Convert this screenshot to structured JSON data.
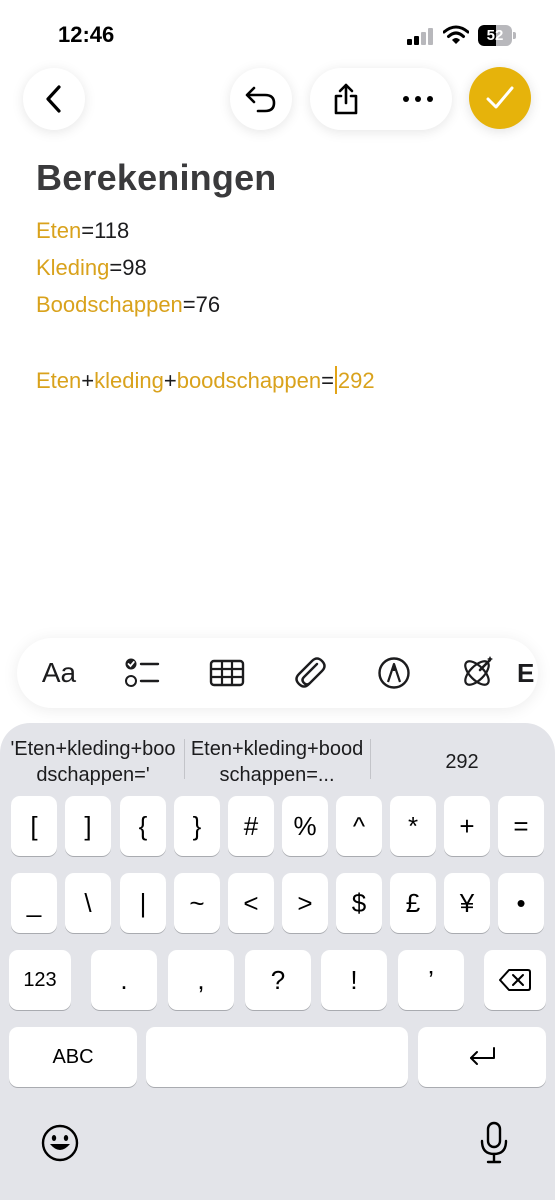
{
  "status_bar": {
    "time": "12:46",
    "battery": "52",
    "battery_level": 0.52
  },
  "toolbar": {
    "back_icon": "chevron-left-icon",
    "undo_icon": "undo-icon",
    "share_icon": "share-icon",
    "more_icon": "ellipsis-icon",
    "done_icon": "checkmark-icon",
    "accent_color": "#e6b30b"
  },
  "note": {
    "title": "Berekeningen",
    "lines": [
      {
        "var": "Eten",
        "rest": "=118"
      },
      {
        "var": "Kleding",
        "rest": "=98"
      },
      {
        "var": "Boodschappen",
        "rest": "=76"
      }
    ],
    "formula": {
      "a": "Eten",
      "op1": "+",
      "b": "kleding",
      "op2": "+",
      "c": "boodschappen",
      "eq": "=",
      "result": "292"
    },
    "variable_color": "#d9a21c"
  },
  "format_bar": {
    "text_style": "Aa",
    "icons": [
      "checklist-icon",
      "table-icon",
      "attachment-icon",
      "markup-icon",
      "writing-tools-icon"
    ]
  },
  "keyboard": {
    "suggestions": [
      "'Eten+kleding+boodschappen='",
      "Eten+kleding+boodschappen=...",
      "292"
    ],
    "row1": [
      "[",
      "]",
      "{",
      "}",
      "#",
      "%",
      "^",
      "*",
      "+",
      "="
    ],
    "row2": [
      "_",
      "\\",
      "|",
      "~",
      "<",
      ">",
      "$",
      "£",
      "¥",
      "•"
    ],
    "row3_mode": "123",
    "row3": [
      ".",
      ",",
      "?",
      "!",
      "’"
    ],
    "abc_label": "ABC",
    "delete_icon": "delete-icon",
    "return_icon": "return-icon",
    "emoji_icon": "emoji-icon",
    "mic_icon": "microphone-icon"
  }
}
